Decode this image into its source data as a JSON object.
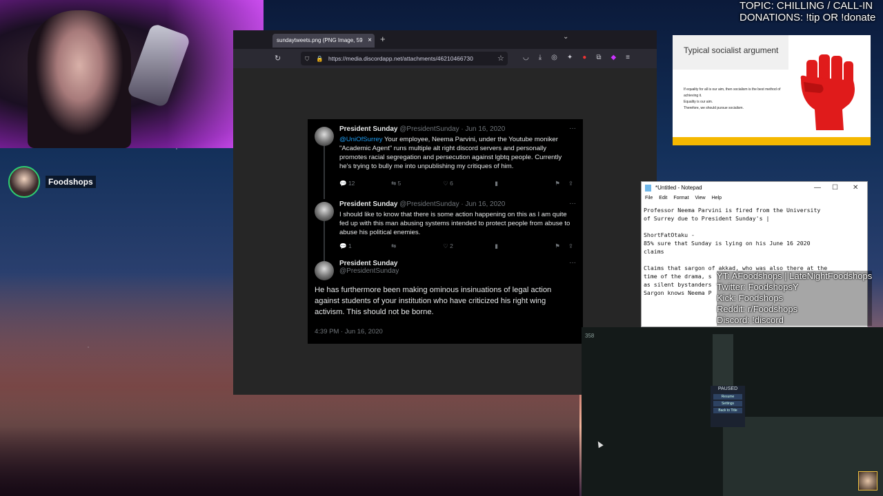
{
  "overlay": {
    "topic": "TOPIC: CHILLING / CALL-IN",
    "donations": "DONATIONS: !tip OR !donate",
    "streamer_name": "Foodshops",
    "socials": [
      "YT: AFoodshops | LateNightFoodshops",
      "Twitter: FoodshopsY",
      "Kick: Foodshops",
      "Reddit: r/Foodshops",
      "Discord: !discord"
    ]
  },
  "browser": {
    "tab_title": "sundaytweets.png (PNG Image, 59",
    "tab_close": "×",
    "new_tab": "+",
    "url": "https://media.discordapp.net/attachments/46210466730",
    "icons": [
      "shield-icon",
      "lock-icon",
      "bookmark-star-icon",
      "pocket-icon",
      "download-icon",
      "extensions-icon",
      "menu-icon"
    ]
  },
  "tweets": [
    {
      "name": "President Sunday",
      "handle_date": "@PresidentSunday · Jun 16, 2020",
      "mention": "@UniOfSurrey",
      "text": " Your employee, Neema Parvini, under the Youtube moniker \"Academic Agent\" runs multiple alt right discord servers and personally promotes racial segregation and persecution against lgbtq people. Currently he's trying to bully me into unpublishing my critiques of him.",
      "replies": "12",
      "retweets": "5",
      "likes": "6"
    },
    {
      "name": "President Sunday",
      "handle_date": "@PresidentSunday · Jun 16, 2020",
      "text": "I should like to know that there is some action happening on this as I am quite fed up with this man abusing systems intended to protect people from abuse to abuse his political enemies.",
      "replies": "1",
      "retweets": "",
      "likes": "2"
    },
    {
      "name": "President Sunday",
      "handle": "@PresidentSunday",
      "text": "He has furthermore been making ominous insinuations of legal action against students of your institution who have criticized his right wing activism. This should not be borne.",
      "timestamp": "4:39 PM · Jun 16, 2020"
    }
  ],
  "slide": {
    "title": "Typical socialist argument",
    "lines": [
      "If equality for all is our aim, then socialism is the best method of achieving it.",
      "Equality is our aim.",
      "Therefore, we should pursue socialism."
    ],
    "accent": "#f5b800",
    "fist_color": "#e01b1b"
  },
  "notepad": {
    "title": "*Untitled - Notepad",
    "menu": [
      "File",
      "Edit",
      "Format",
      "View",
      "Help"
    ],
    "text": "Professor Neema Parvini is fired from the University\nof Surrey due to President Sunday's |\n\nShortFatOtaku -\n85% sure that Sunday is lying on his June 16 2020\nclaims\n\nClaims that sargon of akkad, who was also there at the\ntime of the drama, s\nas silent bystanders\nSargon knows Neema P"
  },
  "game": {
    "counter": "358",
    "paused_label": "PAUSED",
    "options": [
      "Resume",
      "Settings",
      "Back to Title"
    ]
  }
}
